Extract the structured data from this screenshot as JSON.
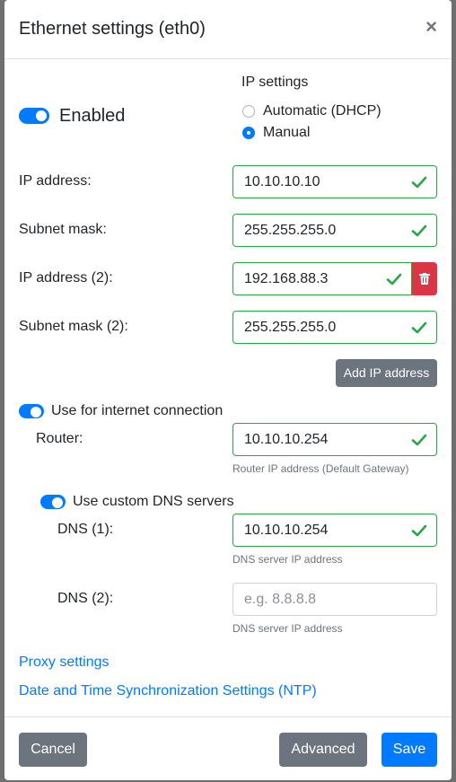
{
  "modal": {
    "title": "Ethernet settings (eth0)",
    "close_glyph": "×"
  },
  "enabled": {
    "label": "Enabled",
    "state": true
  },
  "ip_settings": {
    "heading": "IP settings",
    "options": [
      {
        "label": "Automatic (DHCP)",
        "selected": false
      },
      {
        "label": "Manual",
        "selected": true
      }
    ]
  },
  "fields": {
    "ip1": {
      "label": "IP address:",
      "value": "10.10.10.10"
    },
    "mask1": {
      "label": "Subnet mask:",
      "value": "255.255.255.0"
    },
    "ip2": {
      "label": "IP address (2):",
      "value": "192.168.88.3"
    },
    "mask2": {
      "label": "Subnet mask (2):",
      "value": "255.255.255.0"
    }
  },
  "add_ip_button": "Add IP address",
  "internet": {
    "toggle_label": "Use for internet connection",
    "router_label": "Router:",
    "router_value": "10.10.10.254",
    "router_help": "Router IP address (Default Gateway)"
  },
  "dns": {
    "toggle_label": "Use custom DNS servers",
    "dns1_label": "DNS (1):",
    "dns1_value": "10.10.10.254",
    "dns1_help": "DNS server IP address",
    "dns2_label": "DNS (2):",
    "dns2_placeholder": "e.g. 8.8.8.8",
    "dns2_help": "DNS server IP address"
  },
  "links": {
    "proxy": "Proxy settings",
    "ntp": "Date and Time Synchronization Settings (NTP)"
  },
  "footer": {
    "cancel": "Cancel",
    "advanced": "Advanced",
    "save": "Save"
  },
  "colors": {
    "primary": "#007bff",
    "success": "#28a745",
    "danger": "#dc3545",
    "secondary": "#6c757d"
  }
}
